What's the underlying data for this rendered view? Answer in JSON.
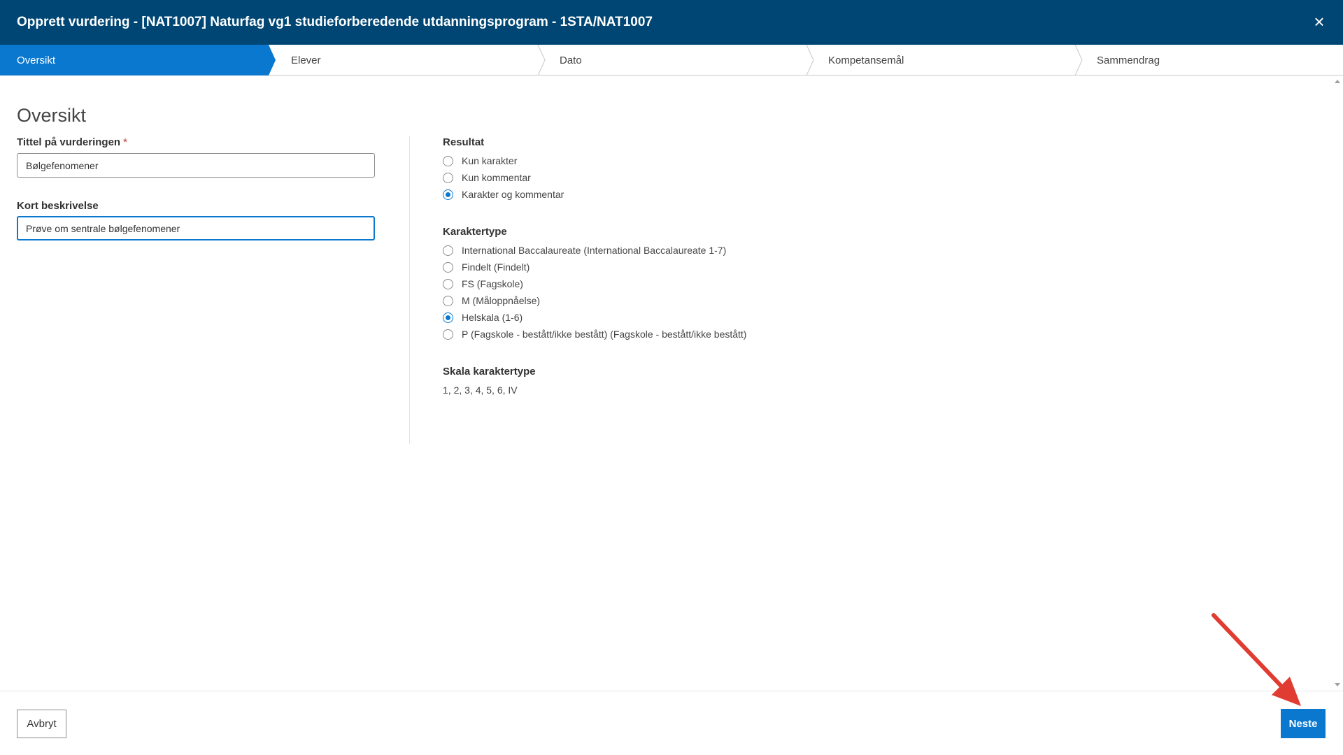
{
  "header": {
    "title": "Opprett vurdering - [NAT1007] Naturfag vg1 studieforberedende utdanningsprogram - 1STA/NAT1007",
    "close_icon": "×"
  },
  "steps": [
    {
      "label": "Oversikt",
      "active": true
    },
    {
      "label": "Elever",
      "active": false
    },
    {
      "label": "Dato",
      "active": false
    },
    {
      "label": "Kompetansemål",
      "active": false
    },
    {
      "label": "Sammendrag",
      "active": false
    }
  ],
  "main": {
    "title": "Oversikt",
    "title_field": {
      "label": "Tittel på vurderingen",
      "required_mark": "*",
      "value": "Bølgefenomener"
    },
    "description_field": {
      "label": "Kort beskrivelse",
      "value": "Prøve om sentrale bølgefenomener"
    },
    "resultat": {
      "label": "Resultat",
      "options": [
        {
          "label": "Kun karakter",
          "checked": false
        },
        {
          "label": "Kun kommentar",
          "checked": false
        },
        {
          "label": "Karakter og kommentar",
          "checked": true
        }
      ]
    },
    "karaktertype": {
      "label": "Karaktertype",
      "options": [
        {
          "label": "International Baccalaureate (International Baccalaureate 1-7)",
          "checked": false
        },
        {
          "label": "Findelt (Findelt)",
          "checked": false
        },
        {
          "label": "FS (Fagskole)",
          "checked": false
        },
        {
          "label": "M (Måloppnåelse)",
          "checked": false
        },
        {
          "label": "Helskala (1-6)",
          "checked": true
        },
        {
          "label": "P (Fagskole - bestått/ikke bestått) (Fagskole - bestått/ikke bestått)",
          "checked": false
        }
      ]
    },
    "skala": {
      "label": "Skala karaktertype",
      "value": "1, 2, 3, 4, 5, 6, IV"
    }
  },
  "footer": {
    "cancel_label": "Avbryt",
    "next_label": "Neste"
  },
  "colors": {
    "header_bg": "#004674",
    "accent": "#0a78cf",
    "annotation_arrow": "#e03c31"
  }
}
